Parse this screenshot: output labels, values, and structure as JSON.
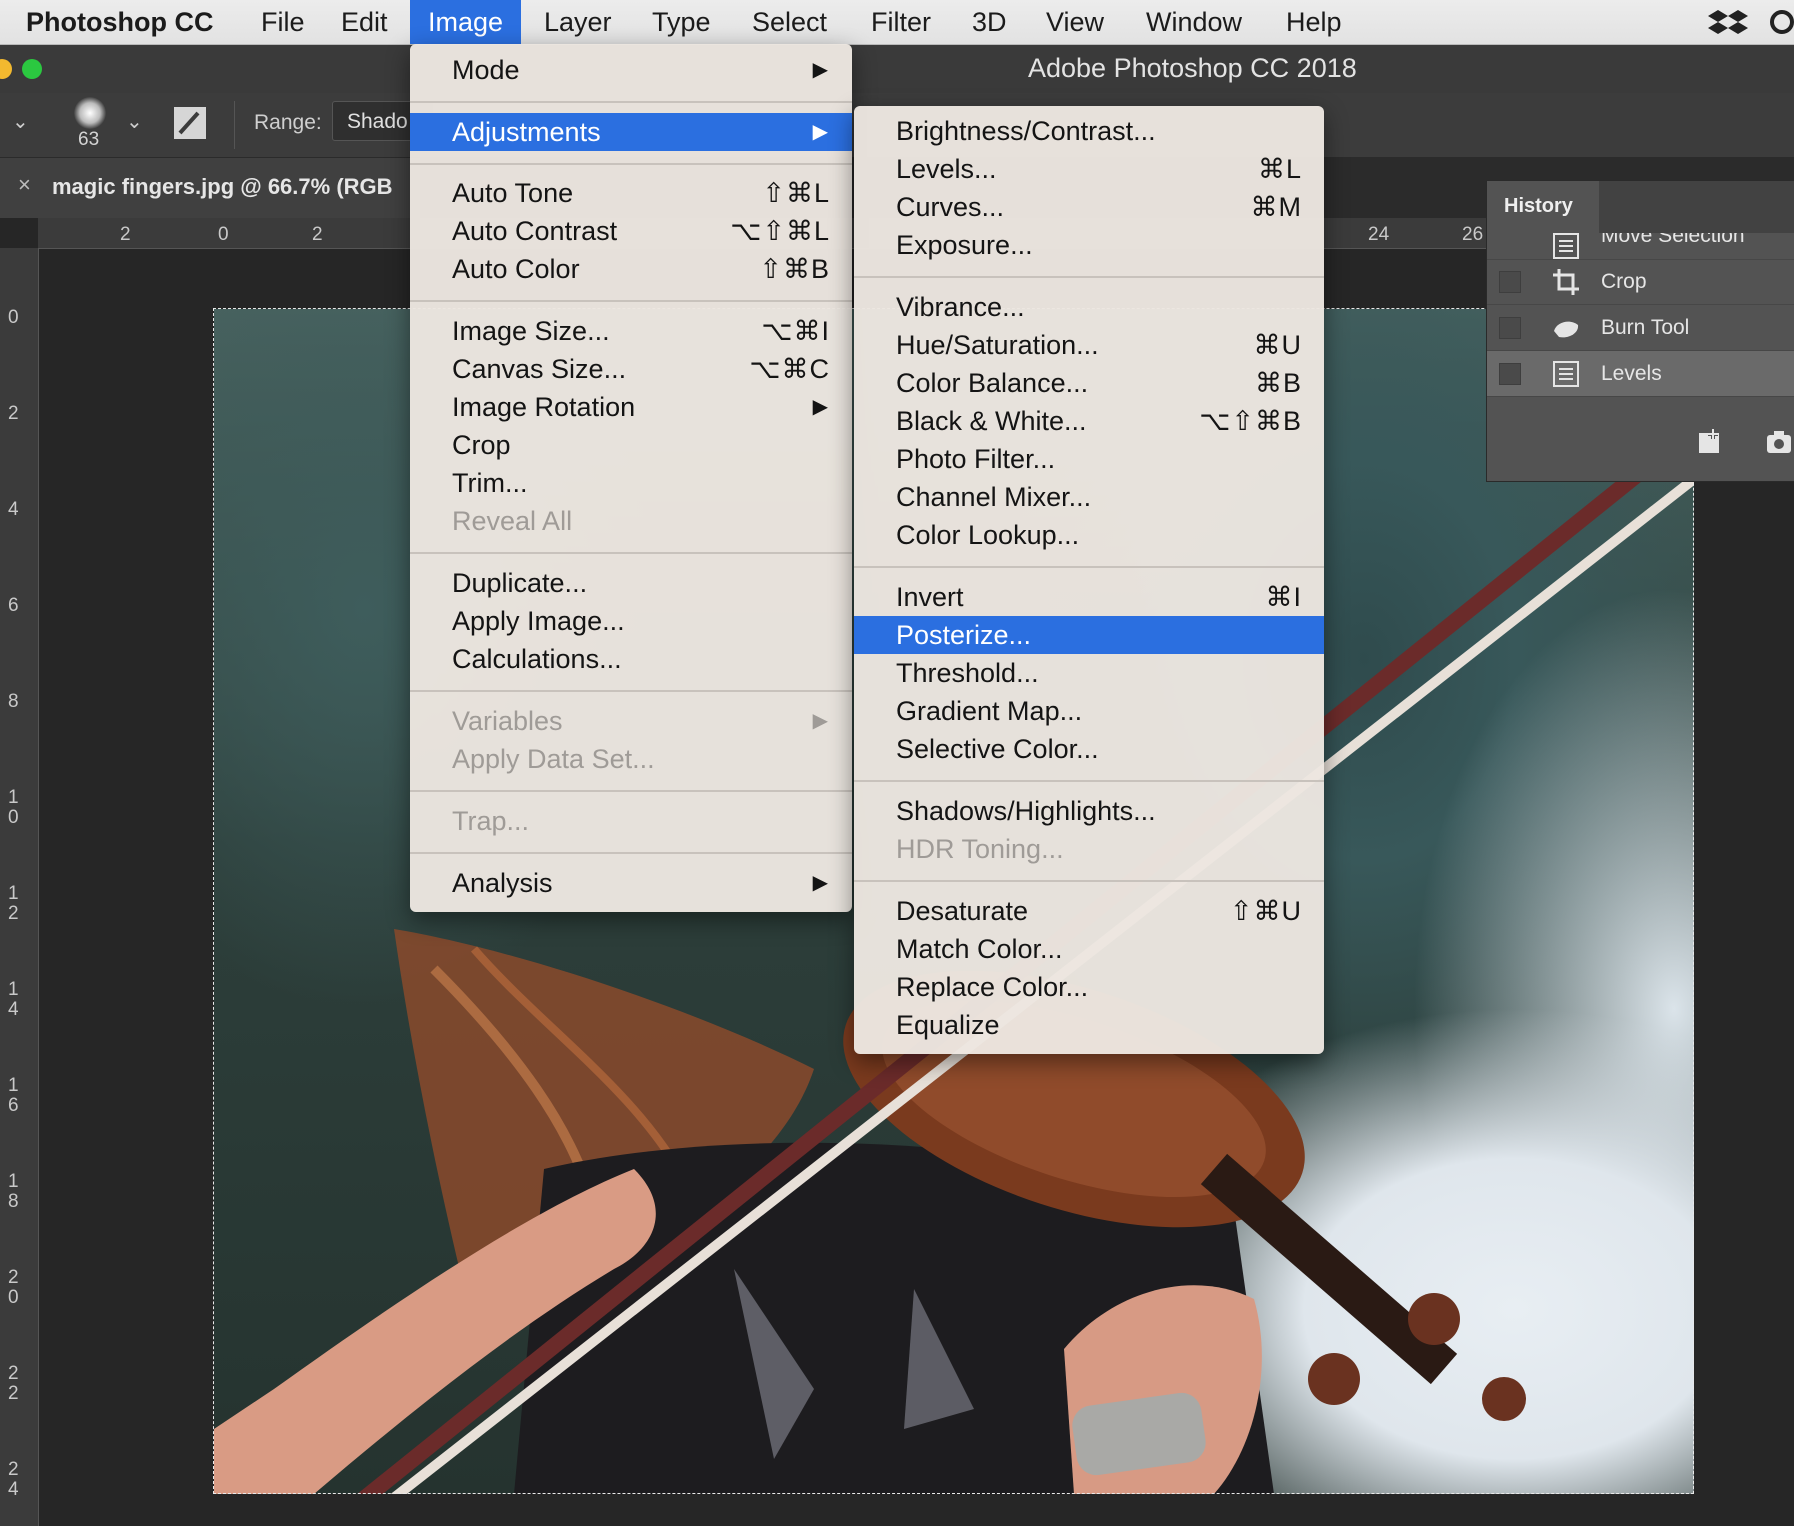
{
  "menubar": {
    "app": "Photoshop CC",
    "items": [
      "File",
      "Edit",
      "Image",
      "Layer",
      "Type",
      "Select",
      "Filter",
      "3D",
      "View",
      "Window",
      "Help"
    ],
    "active": "Image"
  },
  "window": {
    "title": "Adobe Photoshop CC 2018"
  },
  "options": {
    "brush_size": "63",
    "range_label": "Range:",
    "range_value": "Shado"
  },
  "document_tab": {
    "close": "×",
    "title": "magic fingers.jpg @ 66.7% (RGB"
  },
  "rulers": {
    "h_left": [
      "2",
      "0",
      "2"
    ],
    "h_right": [
      "24",
      "26"
    ],
    "v": [
      "0",
      "2",
      "4",
      "6",
      "8",
      "10",
      "12",
      "14",
      "16",
      "18",
      "20",
      "22",
      "24"
    ]
  },
  "image_menu": {
    "items": [
      {
        "label": "Mode",
        "shortcut": "",
        "submenu": true,
        "disabled": false
      },
      {
        "label": "Adjustments",
        "shortcut": "",
        "submenu": true,
        "disabled": false,
        "highlighted": true
      },
      {
        "label": "Auto Tone",
        "shortcut": "⇧⌘L",
        "submenu": false,
        "disabled": false
      },
      {
        "label": "Auto Contrast",
        "shortcut": "⌥⇧⌘L",
        "submenu": false,
        "disabled": false
      },
      {
        "label": "Auto Color",
        "shortcut": "⇧⌘B",
        "submenu": false,
        "disabled": false
      },
      {
        "label": "Image Size...",
        "shortcut": "⌥⌘I",
        "submenu": false,
        "disabled": false
      },
      {
        "label": "Canvas Size...",
        "shortcut": "⌥⌘C",
        "submenu": false,
        "disabled": false
      },
      {
        "label": "Image Rotation",
        "shortcut": "",
        "submenu": true,
        "disabled": false
      },
      {
        "label": "Crop",
        "shortcut": "",
        "submenu": false,
        "disabled": false
      },
      {
        "label": "Trim...",
        "shortcut": "",
        "submenu": false,
        "disabled": false
      },
      {
        "label": "Reveal All",
        "shortcut": "",
        "submenu": false,
        "disabled": true
      },
      {
        "label": "Duplicate...",
        "shortcut": "",
        "submenu": false,
        "disabled": false
      },
      {
        "label": "Apply Image...",
        "shortcut": "",
        "submenu": false,
        "disabled": false
      },
      {
        "label": "Calculations...",
        "shortcut": "",
        "submenu": false,
        "disabled": false
      },
      {
        "label": "Variables",
        "shortcut": "",
        "submenu": true,
        "disabled": true
      },
      {
        "label": "Apply Data Set...",
        "shortcut": "",
        "submenu": false,
        "disabled": true
      },
      {
        "label": "Trap...",
        "shortcut": "",
        "submenu": false,
        "disabled": true
      },
      {
        "label": "Analysis",
        "shortcut": "",
        "submenu": true,
        "disabled": false
      }
    ]
  },
  "adjustments_menu": {
    "items": [
      {
        "label": "Brightness/Contrast...",
        "shortcut": ""
      },
      {
        "label": "Levels...",
        "shortcut": "⌘L"
      },
      {
        "label": "Curves...",
        "shortcut": "⌘M"
      },
      {
        "label": "Exposure...",
        "shortcut": ""
      },
      {
        "label": "Vibrance...",
        "shortcut": ""
      },
      {
        "label": "Hue/Saturation...",
        "shortcut": "⌘U"
      },
      {
        "label": "Color Balance...",
        "shortcut": "⌘B"
      },
      {
        "label": "Black & White...",
        "shortcut": "⌥⇧⌘B"
      },
      {
        "label": "Photo Filter...",
        "shortcut": ""
      },
      {
        "label": "Channel Mixer...",
        "shortcut": ""
      },
      {
        "label": "Color Lookup...",
        "shortcut": ""
      },
      {
        "label": "Invert",
        "shortcut": "⌘I"
      },
      {
        "label": "Posterize...",
        "shortcut": "",
        "highlighted": true
      },
      {
        "label": "Threshold...",
        "shortcut": ""
      },
      {
        "label": "Gradient Map...",
        "shortcut": ""
      },
      {
        "label": "Selective Color...",
        "shortcut": ""
      },
      {
        "label": "Shadows/Highlights...",
        "shortcut": ""
      },
      {
        "label": "HDR Toning...",
        "shortcut": "",
        "disabled": true
      },
      {
        "label": "Desaturate",
        "shortcut": "⇧⌘U"
      },
      {
        "label": "Match Color...",
        "shortcut": ""
      },
      {
        "label": "Replace Color...",
        "shortcut": ""
      },
      {
        "label": "Equalize",
        "shortcut": ""
      }
    ]
  },
  "history": {
    "title": "History",
    "items": [
      {
        "label": "Move Selection",
        "icon": "document-icon"
      },
      {
        "label": "Crop",
        "icon": "crop-icon"
      },
      {
        "label": "Burn Tool",
        "icon": "burn-hand-icon"
      },
      {
        "label": "Levels",
        "icon": "document-icon"
      }
    ]
  },
  "colors": {
    "accent": "#2b6fe0",
    "menu_bg": "#ece6e0",
    "app_bg": "#262626"
  }
}
